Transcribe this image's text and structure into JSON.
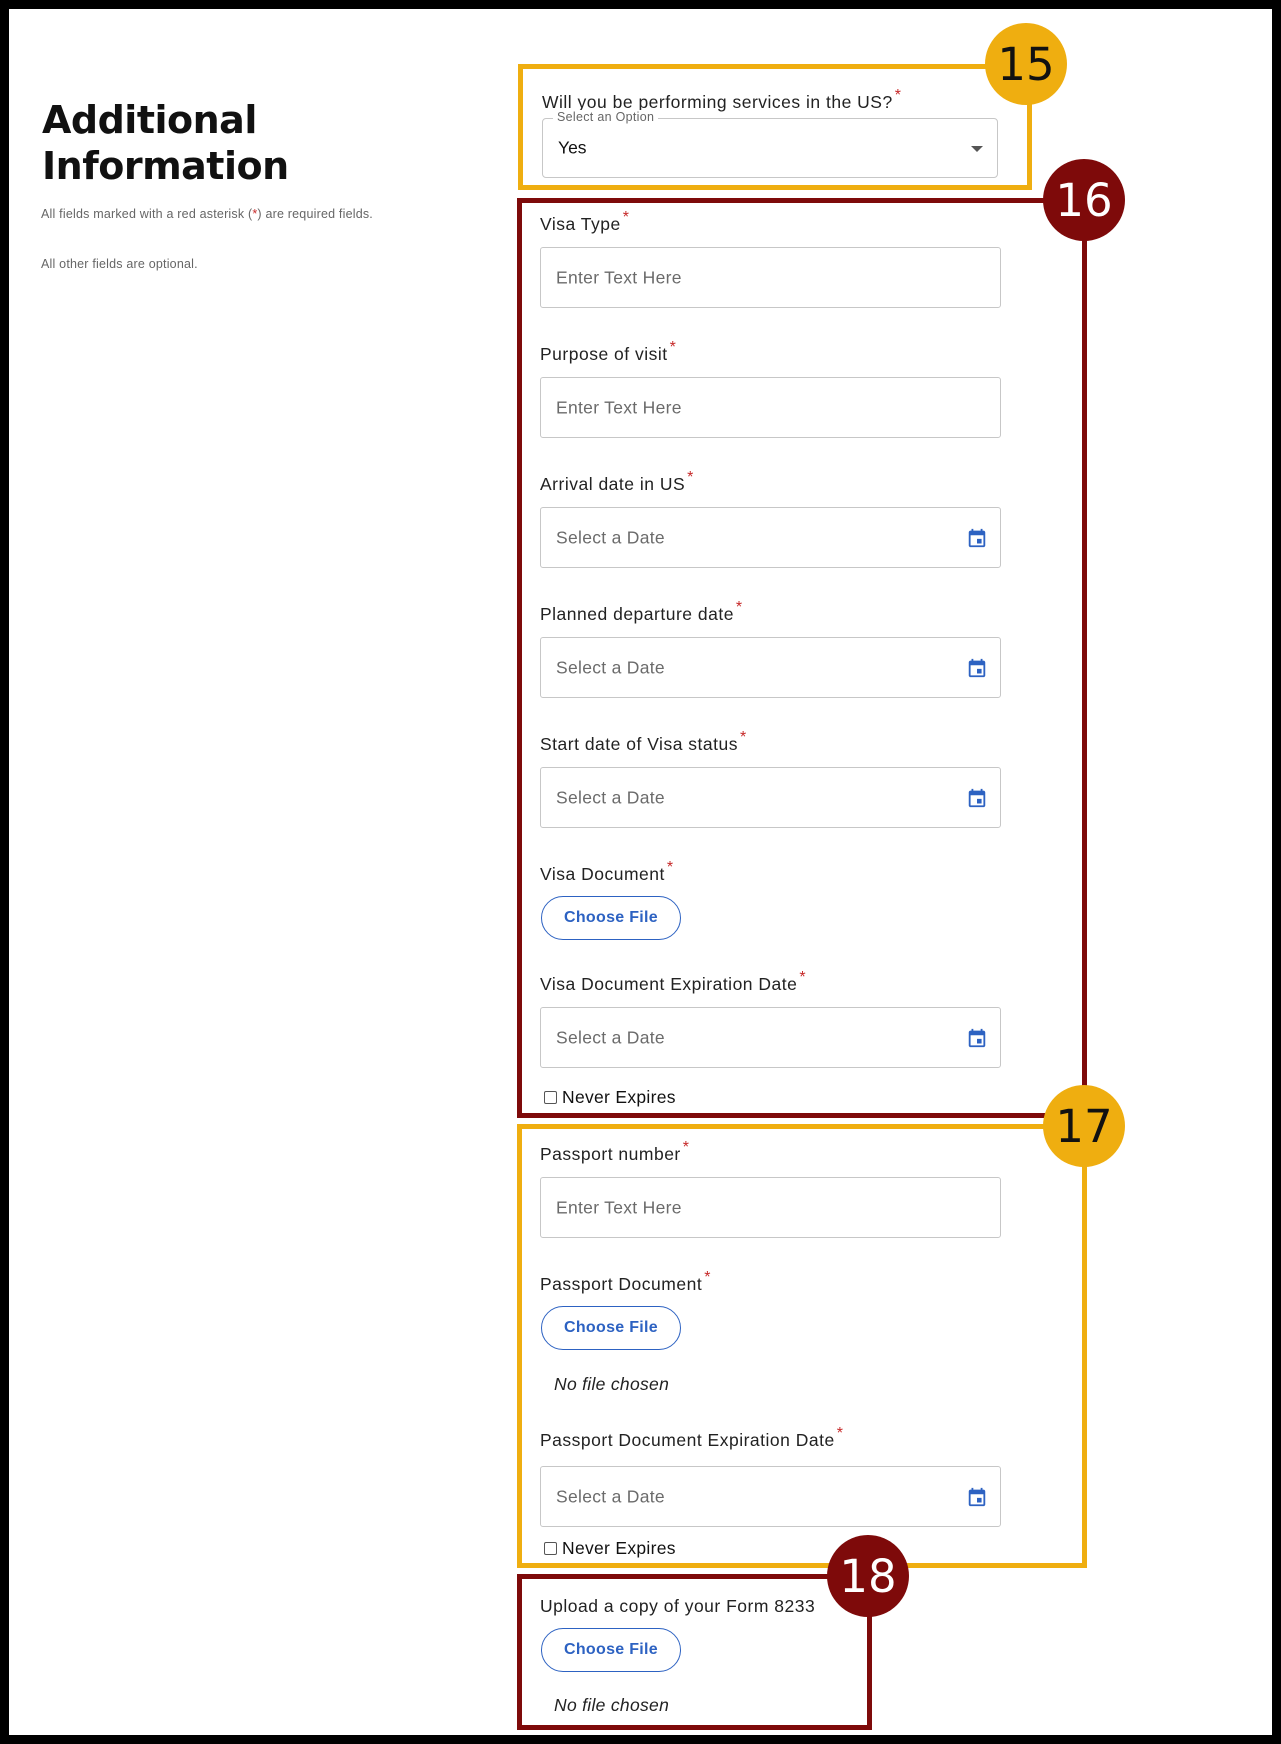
{
  "page": {
    "title": "Additional Information",
    "required_note_pre": "All fields marked with a red asterisk (",
    "required_note_asterisk": "*",
    "required_note_post": ") are required fields.",
    "optional_note": "All other fields are optional."
  },
  "badges": {
    "b15": "15",
    "b16": "16",
    "b17": "17",
    "b18": "18"
  },
  "required_marker": "*",
  "services_question": {
    "label": "Will you be performing services in the US?",
    "legend": "Select an Option",
    "value": "Yes"
  },
  "visa": {
    "visa_type": {
      "label": "Visa Type",
      "placeholder": "Enter Text Here"
    },
    "purpose": {
      "label": "Purpose of visit",
      "placeholder": "Enter Text Here"
    },
    "arrival_date": {
      "label": "Arrival date in US",
      "placeholder": "Select a Date"
    },
    "departure_date": {
      "label": "Planned departure date",
      "placeholder": "Select a Date"
    },
    "start_date": {
      "label": "Start date of Visa status",
      "placeholder": "Select a Date"
    },
    "document": {
      "label": "Visa Document",
      "button": "Choose File"
    },
    "expiration": {
      "label": "Visa Document Expiration Date",
      "placeholder": "Select a Date",
      "never_expires": "Never Expires"
    }
  },
  "passport": {
    "number": {
      "label": "Passport number",
      "placeholder": "Enter Text Here"
    },
    "document": {
      "label": "Passport Document",
      "button": "Choose File",
      "status": "No file chosen"
    },
    "expiration": {
      "label": "Passport Document Expiration Date",
      "placeholder": "Select a Date",
      "never_expires": "Never Expires"
    }
  },
  "form8233": {
    "label": "Upload a copy of your Form 8233",
    "button": "Choose File",
    "status": "No file chosen"
  },
  "colors": {
    "highlight_yellow": "#efae10",
    "highlight_red": "#7e0a0a",
    "required_red": "#c62828",
    "link_blue": "#2d62c2",
    "calendar_icon": "#2d62c2"
  },
  "icons": {
    "calendar": "calendar-icon",
    "dropdown": "caret-down-icon"
  }
}
